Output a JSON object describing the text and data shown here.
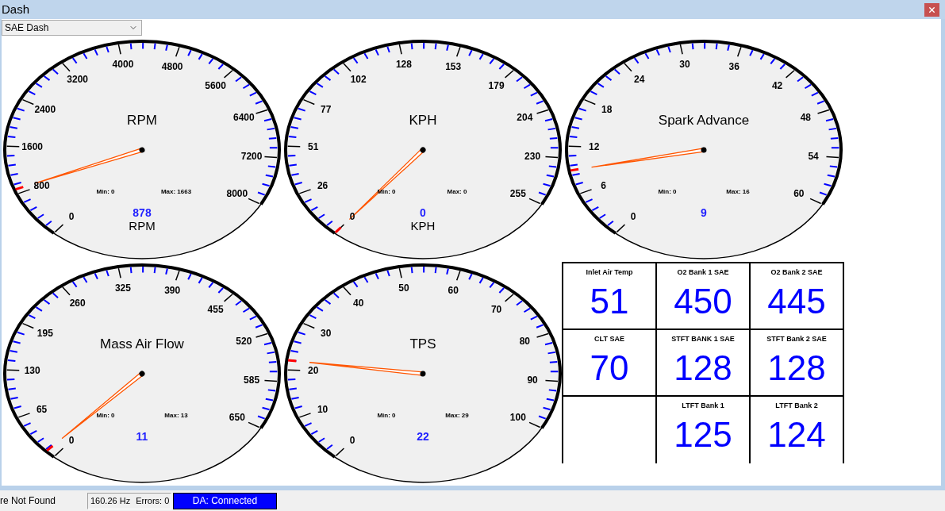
{
  "window": {
    "title": "Dash"
  },
  "dash_selector": {
    "value": "SAE Dash"
  },
  "gauges": [
    {
      "title": "RPM",
      "scale_labels": [
        "0",
        "800",
        "1600",
        "2400",
        "3200",
        "4000",
        "4800",
        "5600",
        "6400",
        "7200",
        "8000"
      ],
      "min_reading": "Min: 0",
      "max_reading": "Max: 1663",
      "value": "878",
      "unit": "RPM"
    },
    {
      "title": "KPH",
      "scale_labels": [
        "0",
        "26",
        "51",
        "77",
        "102",
        "128",
        "153",
        "179",
        "204",
        "230",
        "255"
      ],
      "min_reading": "Min: 0",
      "max_reading": "Max: 0",
      "value": "0",
      "unit": "KPH"
    },
    {
      "title": "Spark Advance",
      "scale_labels": [
        "0",
        "6",
        "12",
        "18",
        "24",
        "30",
        "36",
        "42",
        "48",
        "54",
        "60"
      ],
      "min_reading": "Min: 0",
      "max_reading": "Max: 16",
      "value": "9"
    },
    {
      "title": "Mass Air Flow",
      "scale_labels": [
        "0",
        "65",
        "130",
        "195",
        "260",
        "325",
        "390",
        "455",
        "520",
        "585",
        "650"
      ],
      "min_reading": "Min: 0",
      "max_reading": "Max: 13",
      "value": "11"
    },
    {
      "title": "TPS",
      "scale_labels": [
        "0",
        "10",
        "20",
        "30",
        "40",
        "50",
        "60",
        "70",
        "80",
        "90",
        "100"
      ],
      "min_reading": "Min: 0",
      "max_reading": "Max: 29",
      "value": "22"
    }
  ],
  "readouts": [
    {
      "kind": "reading",
      "label": "Inlet Air Temp",
      "value": "51"
    },
    {
      "kind": "reading",
      "label": "O2 Bank 1 SAE",
      "value": "450"
    },
    {
      "kind": "reading",
      "label": "O2 Bank 2 SAE",
      "value": "445"
    },
    {
      "kind": "reading",
      "label": "CLT SAE",
      "value": "70"
    },
    {
      "kind": "reading",
      "label": "STFT BANK 1 SAE",
      "value": "128"
    },
    {
      "kind": "reading",
      "label": "STFT Bank 2 SAE",
      "value": "128"
    },
    {
      "kind": "blank"
    },
    {
      "kind": "reading",
      "label": "LTFT Bank 1",
      "value": "125"
    },
    {
      "kind": "reading",
      "label": "LTFT Bank 2",
      "value": "124"
    }
  ],
  "status_bar": {
    "message": "re Not Found",
    "rate": "160.26 Hz",
    "errors": "Errors: 0",
    "connection": "DA: Connected"
  }
}
